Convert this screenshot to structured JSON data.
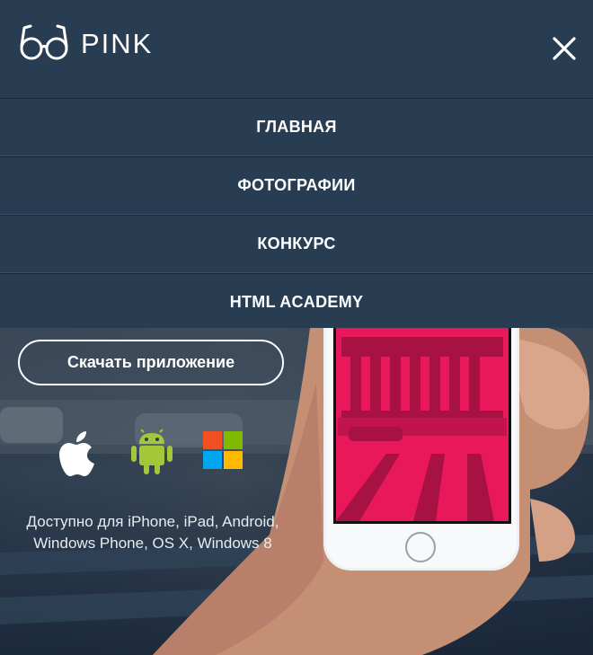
{
  "header": {
    "brand": "PINK",
    "logo_icon": "glasses-icon",
    "close_icon": "close-icon"
  },
  "nav": {
    "items": [
      {
        "label": "ГЛАВНАЯ"
      },
      {
        "label": "ФОТОГРАФИИ"
      },
      {
        "label": "КОНКУРС"
      },
      {
        "label": "HTML ACADEMY"
      }
    ]
  },
  "hero": {
    "download_label": "Скачать приложение",
    "platforms": [
      "apple-icon",
      "android-icon",
      "windows-icon"
    ],
    "availability": {
      "line1": "Доступно для iPhone, iPad, Android,",
      "line2": "Windows Phone, OS X, Windows 8"
    }
  },
  "colors": {
    "header_bg": "#283d52",
    "accent_pink": "#e8185a",
    "android_green": "#a4c639",
    "windows_red": "#f25022",
    "windows_green": "#7fba00",
    "windows_blue": "#00a4ef",
    "windows_yellow": "#ffb900"
  }
}
